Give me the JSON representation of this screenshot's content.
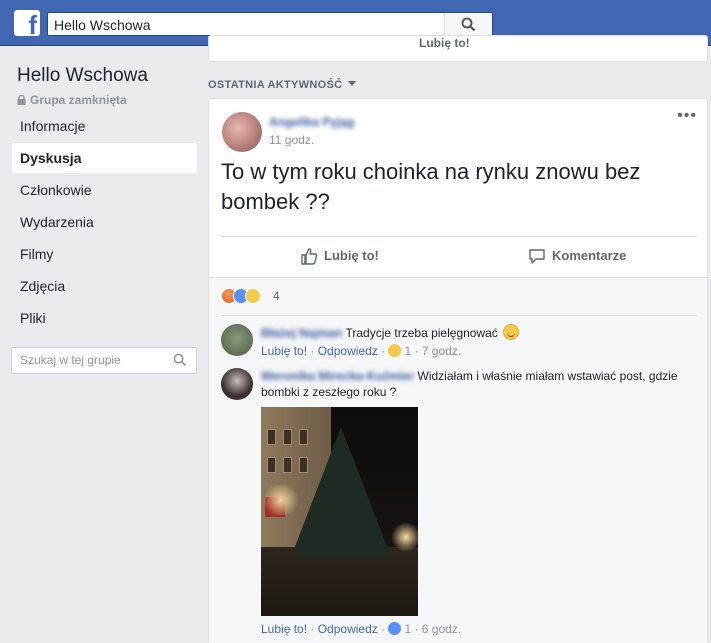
{
  "topbar": {
    "search_value": "Hello Wschowa",
    "logo_letter": "f"
  },
  "sidebar": {
    "group_name": "Hello Wschowa",
    "group_type": "Grupa zamknięta",
    "items": [
      {
        "label": "Informacje",
        "active": false
      },
      {
        "label": "Dyskusja",
        "active": true
      },
      {
        "label": "Członkowie",
        "active": false
      },
      {
        "label": "Wydarzenia",
        "active": false
      },
      {
        "label": "Filmy",
        "active": false
      },
      {
        "label": "Zdjęcia",
        "active": false
      },
      {
        "label": "Pliki",
        "active": false
      }
    ],
    "search_placeholder": "Szukaj w tej grupie"
  },
  "main": {
    "prev_card_label": "Lubię to!",
    "section_header": "OSTATNIA AKTYWNOŚĆ",
    "post": {
      "author": "Angelika Pyjąg",
      "time": "11 godz.",
      "text": "To w tym roku choinka na rynku znowu bez bombek ??",
      "like_label": "Lubię to!",
      "comment_label": "Komentarze",
      "reaction_count": "4",
      "reactions": [
        "angry-reaction",
        "like-reaction",
        "haha-reaction"
      ]
    },
    "comments": [
      {
        "author": "Błażej Najman",
        "text": "Tradycje trzeba pielęgnować",
        "like_label": "Lubię to!",
        "reply_label": "Odpowiedz",
        "reaction_count": "1",
        "time": "7 godz."
      },
      {
        "author": "Weronika Mirecka-Kuźmier",
        "text": "Widziałam i właśnie miałam wstawiać post, gdzie bombki z zeszłego roku ?",
        "like_label": "Lubię to!",
        "reply_label": "Odpowiedz",
        "reaction_count": "1",
        "time": "6 godz."
      }
    ]
  },
  "colors": {
    "brand": "#4267b2",
    "link": "#365899",
    "background": "#e9ebee"
  }
}
